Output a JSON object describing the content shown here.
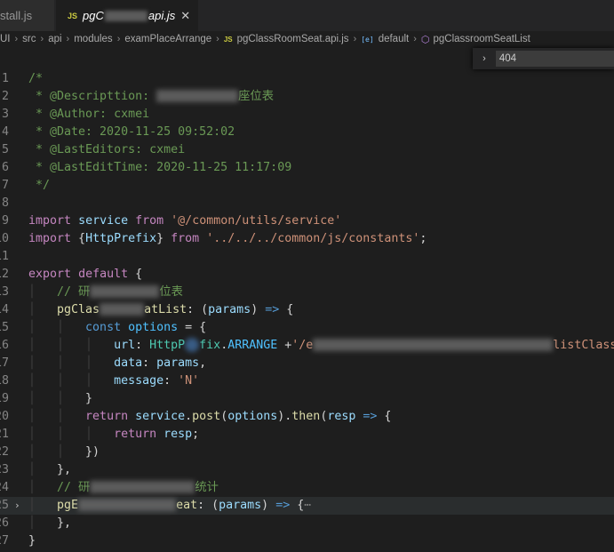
{
  "tabs": [
    {
      "label": "stall.js",
      "active": false
    },
    {
      "icon": "JS",
      "prefix": "pgC",
      "suffix": "api.js",
      "active": true,
      "close": "✕"
    }
  ],
  "breadcrumb": {
    "items": [
      "UI",
      "src",
      "api",
      "modules",
      "examPlaceArrange",
      "pgClassRoomSeat.api.js",
      "default",
      "pgClassroomSeatList"
    ],
    "separator": "›",
    "file_icon": "JS",
    "symbol_icon": "[e]"
  },
  "find": {
    "toggle": "›",
    "value": "404"
  },
  "editor": {
    "lines": [
      {
        "n": "1",
        "parts": [
          [
            "c-com",
            "/*"
          ]
        ]
      },
      {
        "n": "2",
        "parts": [
          [
            "c-com",
            " * @Descripttion: "
          ],
          [
            "blur",
            92
          ],
          [
            "c-com",
            "座位表"
          ]
        ]
      },
      {
        "n": "3",
        "parts": [
          [
            "c-com",
            " * @Author: cxmei"
          ]
        ]
      },
      {
        "n": "4",
        "parts": [
          [
            "c-com",
            " * @Date: 2020-11-25 09:52:02"
          ]
        ]
      },
      {
        "n": "5",
        "parts": [
          [
            "c-com",
            " * @LastEditors: cxmei"
          ]
        ]
      },
      {
        "n": "6",
        "parts": [
          [
            "c-com",
            " * @LastEditTime: 2020-11-25 11:17:09"
          ]
        ]
      },
      {
        "n": "7",
        "parts": [
          [
            "c-com",
            " */"
          ]
        ]
      },
      {
        "n": "8",
        "parts": []
      },
      {
        "n": "9",
        "parts": [
          [
            "c-ctl",
            "import"
          ],
          [
            "c-pun",
            " "
          ],
          [
            "c-var",
            "service"
          ],
          [
            "c-pun",
            " "
          ],
          [
            "c-ctl",
            "from"
          ],
          [
            "c-pun",
            " "
          ],
          [
            "c-str",
            "'@/common/utils/service'"
          ]
        ]
      },
      {
        "n": "10",
        "parts": [
          [
            "c-ctl",
            "import"
          ],
          [
            "c-pun",
            " {"
          ],
          [
            "c-var",
            "HttpPrefix"
          ],
          [
            "c-pun",
            "} "
          ],
          [
            "c-ctl",
            "from"
          ],
          [
            "c-pun",
            " "
          ],
          [
            "c-str",
            "'../../../common/js/constants'"
          ],
          [
            "c-pun",
            ";"
          ]
        ]
      },
      {
        "n": "11",
        "parts": []
      },
      {
        "n": "12",
        "parts": [
          [
            "c-ctl",
            "export"
          ],
          [
            "c-pun",
            " "
          ],
          [
            "c-ctl",
            "default"
          ],
          [
            "c-pun",
            " {"
          ]
        ]
      },
      {
        "n": "13",
        "parts": [
          [
            "indent",
            "    "
          ],
          [
            "c-com",
            "// 研"
          ],
          [
            "blur",
            78
          ],
          [
            "c-com",
            "位表"
          ]
        ]
      },
      {
        "n": "14",
        "parts": [
          [
            "indent",
            "    "
          ],
          [
            "c-fn",
            "pgClas"
          ],
          [
            "blur",
            50
          ],
          [
            "c-fn",
            "atList"
          ],
          [
            "c-pun",
            ": ("
          ],
          [
            "c-var",
            "params"
          ],
          [
            "c-pun",
            ") "
          ],
          [
            "c-kw",
            "=>"
          ],
          [
            "c-pun",
            " {"
          ]
        ]
      },
      {
        "n": "15",
        "parts": [
          [
            "indent",
            "        "
          ],
          [
            "c-kw",
            "const"
          ],
          [
            "c-pun",
            " "
          ],
          [
            "c-const",
            "options"
          ],
          [
            "c-pun",
            " = {"
          ]
        ]
      },
      {
        "n": "16",
        "parts": [
          [
            "indent",
            "            "
          ],
          [
            "c-var",
            "url"
          ],
          [
            "c-pun",
            ": "
          ],
          [
            "c-cls",
            "HttpP"
          ],
          [
            "round",
            0
          ],
          [
            "c-cls",
            "fix"
          ],
          [
            "c-pun",
            "."
          ],
          [
            "c-const",
            "ARRANGE"
          ],
          [
            "c-pun",
            " +"
          ],
          [
            "c-str",
            "'/e"
          ],
          [
            "blur",
            270
          ],
          [
            "c-str",
            "listClass"
          ]
        ]
      },
      {
        "n": "17",
        "parts": [
          [
            "indent",
            "            "
          ],
          [
            "c-var",
            "data"
          ],
          [
            "c-pun",
            ": "
          ],
          [
            "c-var",
            "params"
          ],
          [
            "c-pun",
            ","
          ]
        ]
      },
      {
        "n": "18",
        "parts": [
          [
            "indent",
            "            "
          ],
          [
            "c-var",
            "message"
          ],
          [
            "c-pun",
            ": "
          ],
          [
            "c-str",
            "'N'"
          ]
        ]
      },
      {
        "n": "19",
        "parts": [
          [
            "indent",
            "        "
          ],
          [
            "c-pun",
            "}"
          ]
        ]
      },
      {
        "n": "20",
        "parts": [
          [
            "indent",
            "        "
          ],
          [
            "c-ctl",
            "return"
          ],
          [
            "c-pun",
            " "
          ],
          [
            "c-var",
            "service"
          ],
          [
            "c-pun",
            "."
          ],
          [
            "c-fn",
            "post"
          ],
          [
            "c-pun",
            "("
          ],
          [
            "c-var",
            "options"
          ],
          [
            "c-pun",
            ")."
          ],
          [
            "c-fn",
            "then"
          ],
          [
            "c-pun",
            "("
          ],
          [
            "c-var",
            "resp"
          ],
          [
            "c-pun",
            " "
          ],
          [
            "c-kw",
            "=>"
          ],
          [
            "c-pun",
            " {"
          ]
        ]
      },
      {
        "n": "21",
        "parts": [
          [
            "indent",
            "            "
          ],
          [
            "c-ctl",
            "return"
          ],
          [
            "c-pun",
            " "
          ],
          [
            "c-var",
            "resp"
          ],
          [
            "c-pun",
            ";"
          ]
        ]
      },
      {
        "n": "22",
        "parts": [
          [
            "indent",
            "        "
          ],
          [
            "c-pun",
            "})"
          ]
        ]
      },
      {
        "n": "23",
        "parts": [
          [
            "indent",
            "    "
          ],
          [
            "c-pun",
            "},"
          ]
        ]
      },
      {
        "n": "24",
        "parts": [
          [
            "indent",
            "    "
          ],
          [
            "c-com",
            "// 研"
          ],
          [
            "blur",
            118
          ],
          [
            "c-com",
            "统计"
          ]
        ]
      },
      {
        "n": "25",
        "fold": "›",
        "highlight": true,
        "parts": [
          [
            "indent",
            "    "
          ],
          [
            "c-fn",
            "pgE"
          ],
          [
            "blur",
            110
          ],
          [
            "c-fn",
            "eat"
          ],
          [
            "c-pun",
            ": ("
          ],
          [
            "c-var",
            "params"
          ],
          [
            "c-pun",
            ") "
          ],
          [
            "c-kw",
            "=>"
          ],
          [
            "c-pun",
            " {"
          ],
          [
            "c-dim",
            "⋯"
          ]
        ]
      },
      {
        "n": "26",
        "parts": [
          [
            "indent",
            "    "
          ],
          [
            "c-pun",
            "},"
          ]
        ]
      },
      {
        "n": "27",
        "parts": [
          [
            "c-pun",
            "}"
          ]
        ]
      }
    ]
  }
}
